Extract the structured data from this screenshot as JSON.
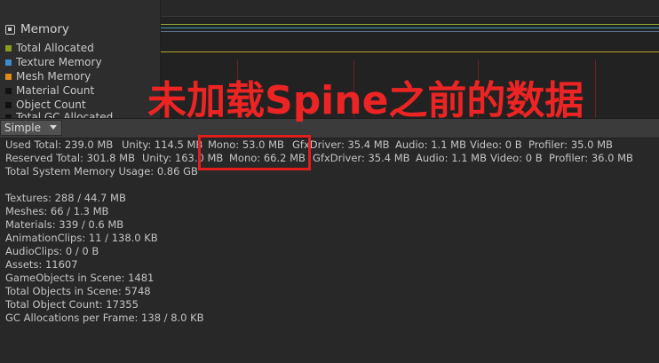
{
  "profiler": {
    "memory_header": "Memory",
    "legend": [
      {
        "label": "Total Allocated",
        "color": "#8c9b1e"
      },
      {
        "label": "Texture Memory",
        "color": "#3c8ccf"
      },
      {
        "label": "Mesh Memory",
        "color": "#e08a18"
      },
      {
        "label": "Material Count",
        "color": "#111111"
      },
      {
        "label": "Object Count",
        "color": "#111111"
      },
      {
        "label": "Total GC Allocated",
        "color": "#111111"
      }
    ],
    "graph_colors": {
      "yellow": "#b8a41c",
      "cyan": "#3fa0b4",
      "green": "#8aa83a"
    }
  },
  "toolbar": {
    "mode": "Simple"
  },
  "stats": {
    "used": {
      "total": "Used Total: 239.0 MB",
      "unity": "Unity: 114.5 MB",
      "mono": "Mono: 53.0 MB",
      "gfx": "GfxDriver: 35.4 MB",
      "audio": "Audio: 1.1 MB",
      "video": "Video: 0 B",
      "profiler": "Profiler: 35.0 MB"
    },
    "reserved": {
      "total": "Reserved Total: 301.8 MB",
      "unity": "Unity: 163.0 MB",
      "mono": "Mono: 66.2 MB",
      "gfx": "GfxDriver: 35.4 MB",
      "audio": "Audio: 1.1 MB",
      "video": "Video: 0 B",
      "profiler": "Profiler: 36.0 MB"
    },
    "system": "Total System Memory Usage: 0.86 GB",
    "details": [
      "Textures: 288 / 44.7 MB",
      "Meshes: 66 / 1.3 MB",
      "Materials: 339 / 0.6 MB",
      "AnimationClips: 11 / 138.0 KB",
      "AudioClips: 0 / 0 B",
      "Assets: 11607",
      "GameObjects in Scene: 1481",
      "Total Objects in Scene: 5748",
      "Total Object Count: 17355",
      "GC Allocations per Frame: 138 / 8.0 KB"
    ]
  },
  "overlay": {
    "text": "未加载Spine之前的数据",
    "color": "#ec2424"
  }
}
